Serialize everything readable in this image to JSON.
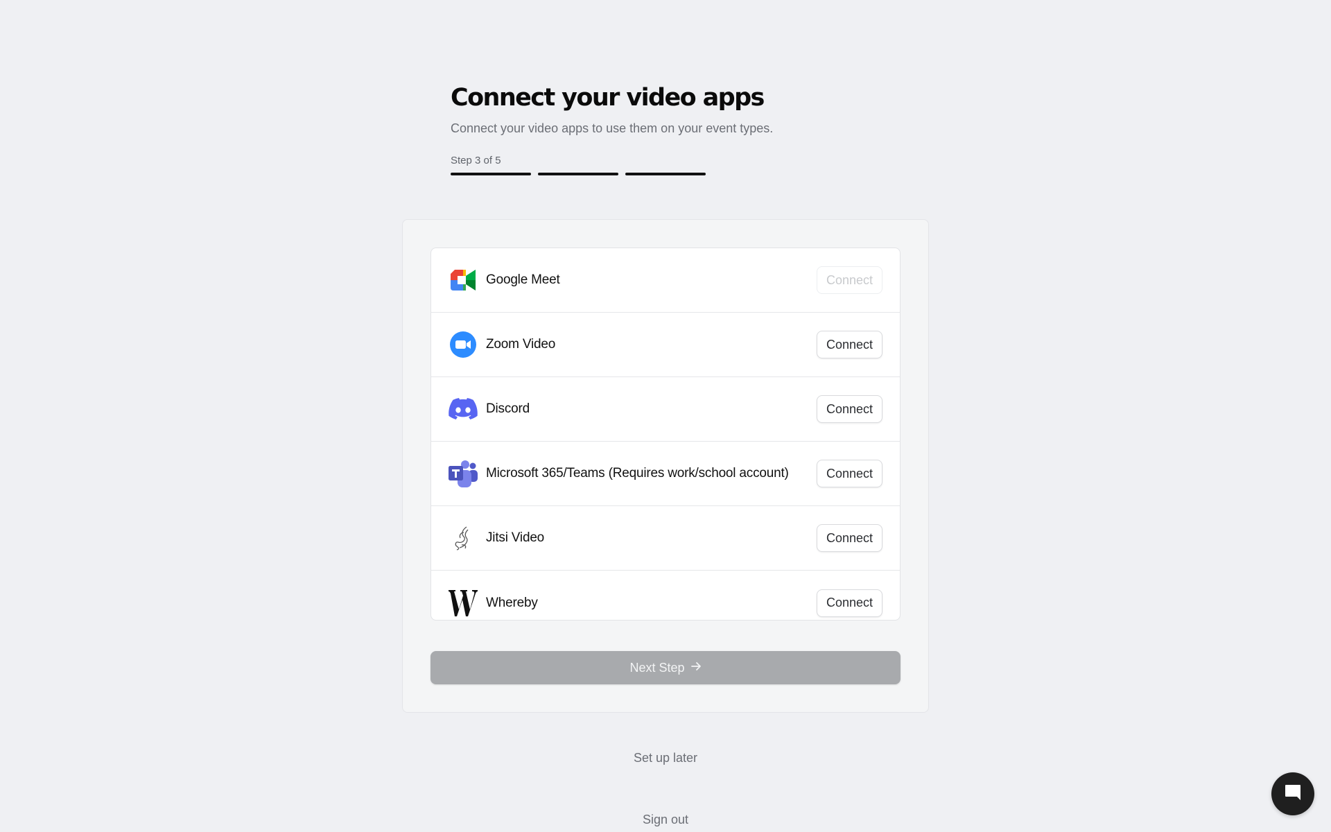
{
  "header": {
    "title": "Connect your video apps",
    "subtitle": "Connect your video apps to use them on your event types.",
    "step_label": "Step 3 of 5"
  },
  "apps": [
    {
      "name": "Google Meet",
      "icon": "google-meet-icon",
      "button": "Connect",
      "button_disabled": true
    },
    {
      "name": "Zoom Video",
      "icon": "zoom-icon",
      "button": "Connect",
      "button_disabled": false
    },
    {
      "name": "Discord",
      "icon": "discord-icon",
      "button": "Connect",
      "button_disabled": false
    },
    {
      "name": "Microsoft 365/Teams (Requires work/school account)",
      "icon": "microsoft-teams-icon",
      "button": "Connect",
      "button_disabled": false
    },
    {
      "name": "Jitsi Video",
      "icon": "jitsi-icon",
      "button": "Connect",
      "button_disabled": false
    },
    {
      "name": "Whereby",
      "icon": "whereby-icon",
      "button": "Connect",
      "button_disabled": false
    }
  ],
  "next_button": {
    "label": "Next Step",
    "icon": "arrow-right-icon",
    "disabled": true
  },
  "links": {
    "setup_later": "Set up later",
    "sign_out": "Sign out"
  },
  "chat": {
    "icon": "chat-bubble-icon"
  },
  "colors": {
    "background": "#eff0f3",
    "zoom": "#2d8cff",
    "discord": "#5865f2",
    "teams": "#5059c9"
  }
}
